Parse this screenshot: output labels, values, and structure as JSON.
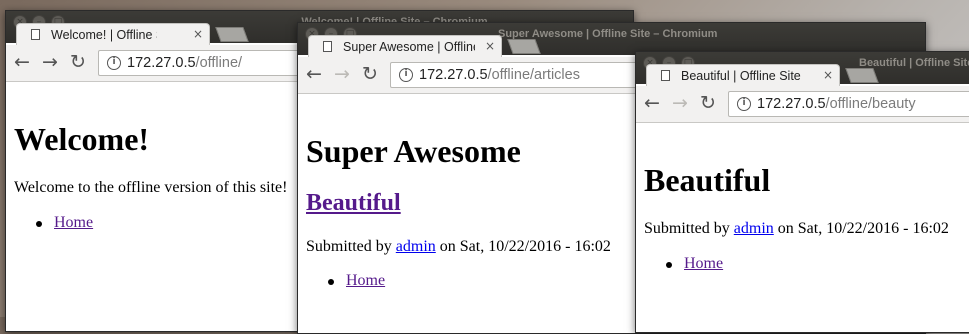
{
  "windows": [
    {
      "title": "Welcome! | Offline Site – Chromium",
      "tab_label": "Welcome! | Offline Site",
      "url_host": "172.27.0.5",
      "url_path": "/offline/",
      "heading": "Welcome!",
      "body_text": "Welcome to the offline version of this site!",
      "menu": [
        "Home"
      ]
    },
    {
      "title": "Super Awesome | Offline Site – Chromium",
      "tab_label": "Super Awesome | Offline Site",
      "url_host": "172.27.0.5",
      "url_path": "/offline/articles",
      "heading": "Super Awesome",
      "article_title": "Beautiful",
      "submitted_prefix": "Submitted by ",
      "author": "admin",
      "submitted_suffix": " on Sat, 10/22/2016 - 16:02",
      "menu": [
        "Home"
      ]
    },
    {
      "title": "Beautiful | Offline Site – Chromium",
      "tab_label": "Beautiful | Offline Site",
      "url_host": "172.27.0.5",
      "url_path": "/offline/beauty",
      "heading": "Beautiful",
      "submitted_prefix": "Submitted by ",
      "author": "admin",
      "submitted_suffix": " on Sat, 10/22/2016 - 16:02",
      "menu": [
        "Home"
      ]
    }
  ]
}
